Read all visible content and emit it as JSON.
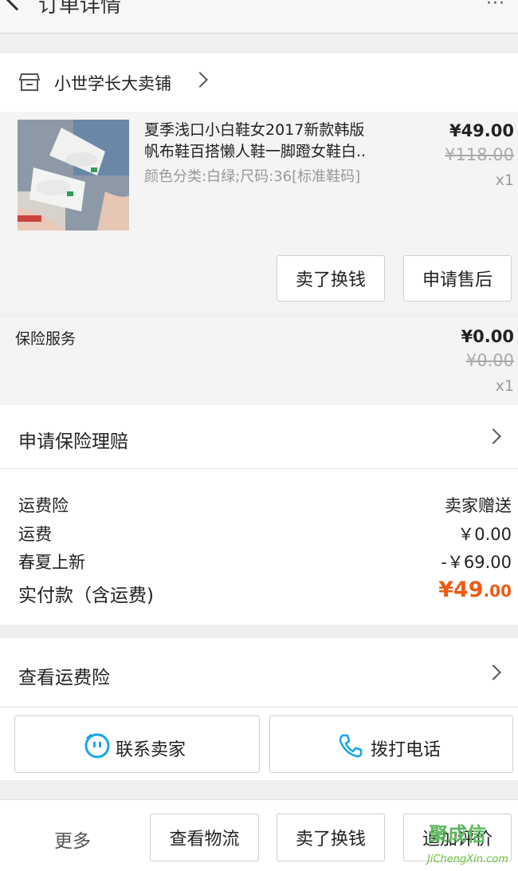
{
  "header": {
    "title": "订单详情",
    "more": "···"
  },
  "store": {
    "name": "小世学长大卖铺"
  },
  "product": {
    "title_line1": "夏季浅口小白鞋女2017新款韩版",
    "title_line2": "帆布鞋百搭懒人鞋一脚蹬女鞋白..",
    "sku": "颜色分类:白绿;尺码:36[标准鞋码]",
    "price": "¥49.00",
    "original_price": "¥118.00",
    "quantity": "x1",
    "buttons": {
      "sell": "卖了换钱",
      "aftersale": "申请售后"
    }
  },
  "insurance": {
    "label": "保险服务",
    "price": "¥0.00",
    "original_price": "¥0.00",
    "quantity": "x1"
  },
  "claim": {
    "label": "申请保险理赔"
  },
  "fees": {
    "items": [
      {
        "label": "运费险",
        "value": "卖家赠送"
      },
      {
        "label": "运费",
        "value": "￥0.00"
      },
      {
        "label": "春夏上新",
        "value": "-￥69.00"
      }
    ],
    "total_label": "实付款（含运费)",
    "total_main": "¥49",
    "total_cents": ".00"
  },
  "shipping_insurance": {
    "label": "查看运费险"
  },
  "contact": {
    "seller": "联系卖家",
    "call": "拨打电话"
  },
  "bottom": {
    "more": "更多",
    "logistics": "查看物流",
    "sell": "卖了换钱",
    "review": "追加评价"
  },
  "watermark": {
    "logo": "聚成信",
    "url": "JiChengXin.com"
  },
  "colors": {
    "accent": "#f05a14",
    "icon_blue": "#1aa5e6"
  }
}
